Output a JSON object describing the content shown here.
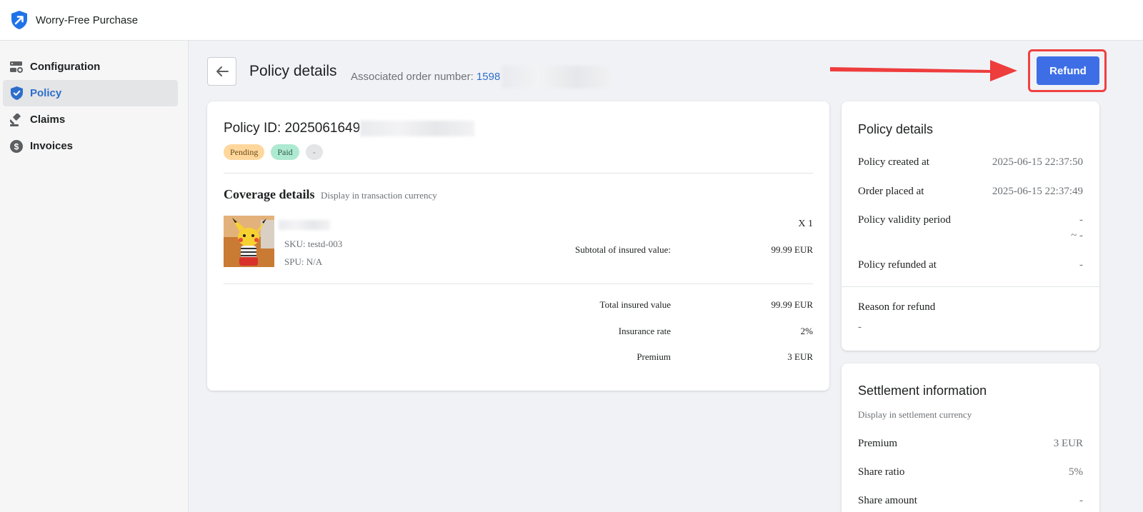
{
  "app": {
    "title": "Worry-Free Purchase"
  },
  "sidebar": {
    "items": [
      {
        "label": "Configuration",
        "icon": "settings-icon",
        "active": false
      },
      {
        "label": "Policy",
        "icon": "shield-icon",
        "active": true
      },
      {
        "label": "Claims",
        "icon": "gavel-icon",
        "active": false
      },
      {
        "label": "Invoices",
        "icon": "dollar-icon",
        "active": false
      }
    ]
  },
  "header": {
    "title": "Policy details",
    "order_label": "Associated order number:",
    "order_number_visible": "1598",
    "refund_label": "Refund"
  },
  "policy": {
    "id_label": "Policy ID: 2025061649",
    "badges": [
      "Pending",
      "Paid",
      "-"
    ],
    "coverage_title": "Coverage details",
    "coverage_subtitle": "Display in transaction currency",
    "item": {
      "sku": "SKU: testd-003",
      "spu": "SPU: N/A",
      "qty": "X 1"
    },
    "subtotal_label": "Subtotal of insured value:",
    "subtotal_value": "99.99 EUR",
    "totals": [
      {
        "label": "Total insured value",
        "value": "99.99 EUR"
      },
      {
        "label": "Insurance rate",
        "value": "2%"
      },
      {
        "label": "Premium",
        "value": "3 EUR"
      }
    ]
  },
  "details_panel": {
    "title": "Policy details",
    "rows": [
      {
        "label": "Policy created at",
        "value": "2025-06-15 22:37:50"
      },
      {
        "label": "Order placed at",
        "value": "2025-06-15 22:37:49"
      },
      {
        "label": "Policy validity period",
        "value": "-",
        "value2": "~ -"
      },
      {
        "label": "Policy refunded at",
        "value": "-"
      }
    ],
    "reason_label": "Reason for refund",
    "reason_value": "-"
  },
  "settlement": {
    "title": "Settlement information",
    "subtitle": "Display in settlement currency",
    "rows": [
      {
        "label": "Premium",
        "value": "3 EUR"
      },
      {
        "label": "Share ratio",
        "value": "5%"
      },
      {
        "label": "Share amount",
        "value": "-"
      }
    ]
  },
  "colors": {
    "accent": "#2c6ecb",
    "refund_button": "#3e6ee6",
    "highlight": "#ef4040"
  }
}
